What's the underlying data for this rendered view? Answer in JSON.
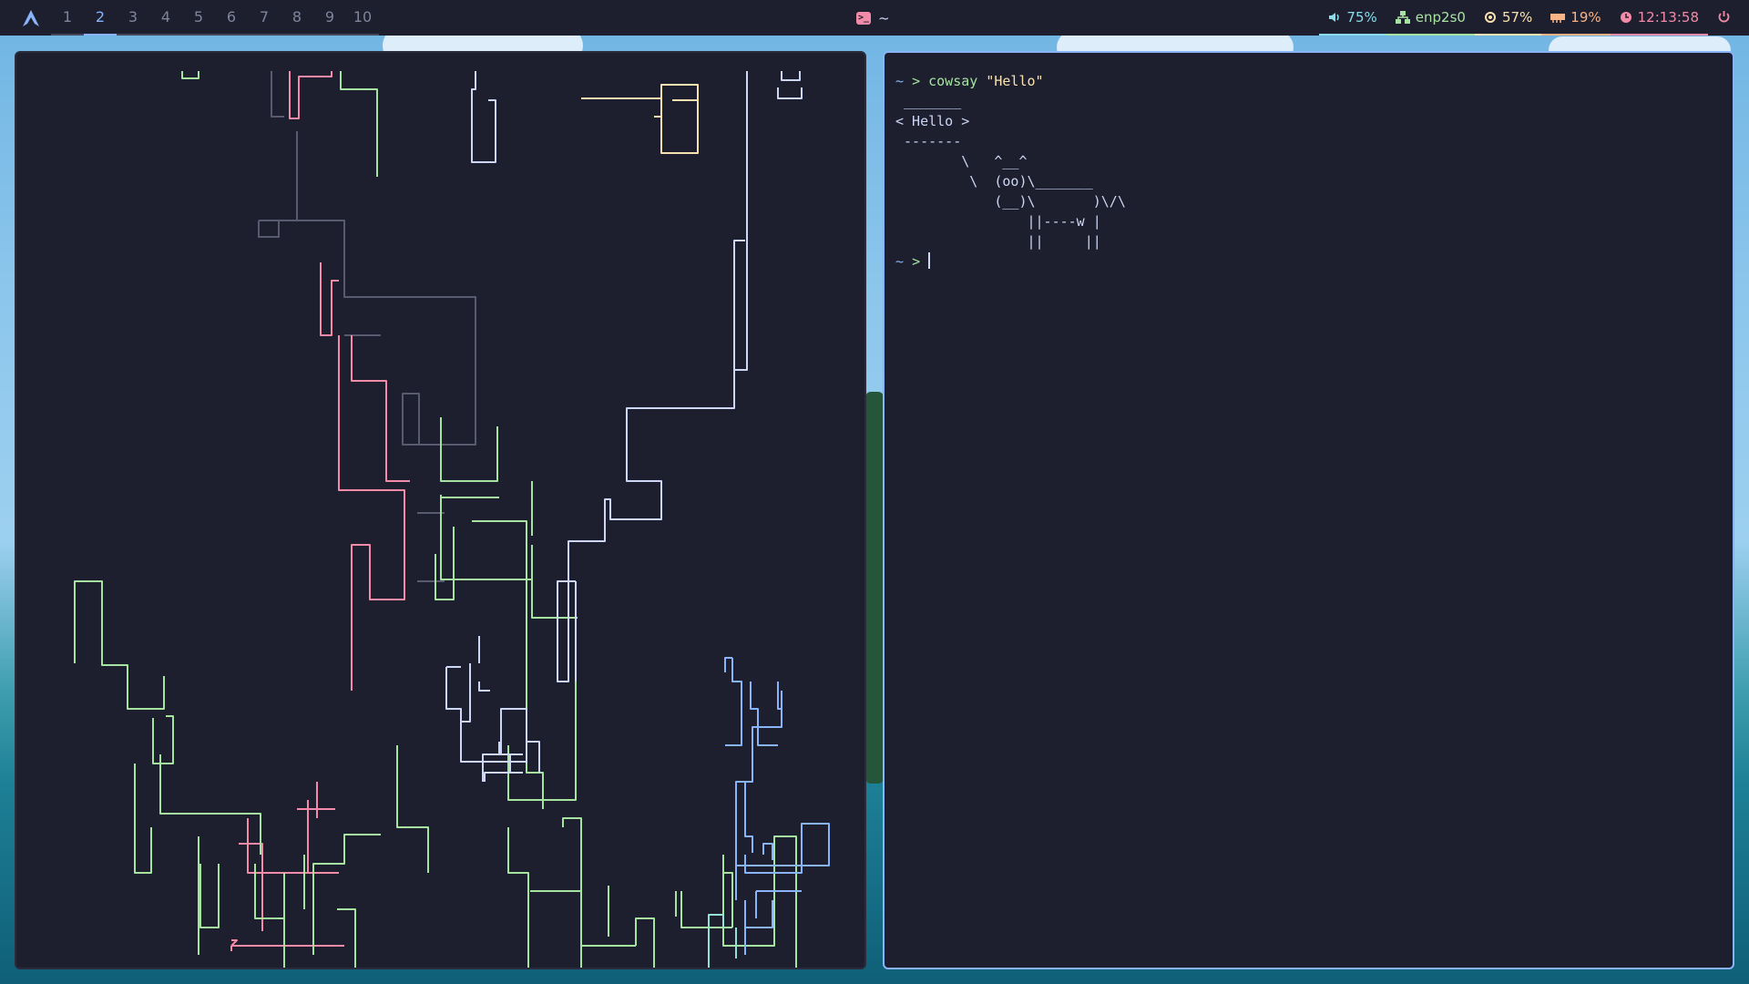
{
  "bar": {
    "logo_icon": "arch-icon",
    "workspaces": [
      "1",
      "2",
      "3",
      "4",
      "5",
      "6",
      "7",
      "8",
      "9",
      "10"
    ],
    "active_workspace_index": 1,
    "window_title": "~",
    "window_icon": "terminal-icon",
    "modules": {
      "volume": "75%",
      "network": "enp2s0",
      "cpu": "57%",
      "memory": "19%",
      "clock": "12:13:58"
    },
    "power_icon": "power-icon"
  },
  "terminal": {
    "prompt_tilde": "~",
    "prompt_arrow": ">",
    "command": "cowsay",
    "argument": "\"Hello\"",
    "output": " _______\n< Hello >\n -------\n        \\   ^__^\n         \\  (oo)\\_______\n            (__)\\       )\\/\\\n                ||----w |\n                ||     ||"
  },
  "pipes": {
    "colors": {
      "gray": "#585b70",
      "pink": "#f38ba8",
      "green": "#a6e3a1",
      "yellow": "#f9e2af",
      "blue": "#89b4fa",
      "lavender": "#cdd6f4",
      "teal": "#94e2d5"
    }
  }
}
